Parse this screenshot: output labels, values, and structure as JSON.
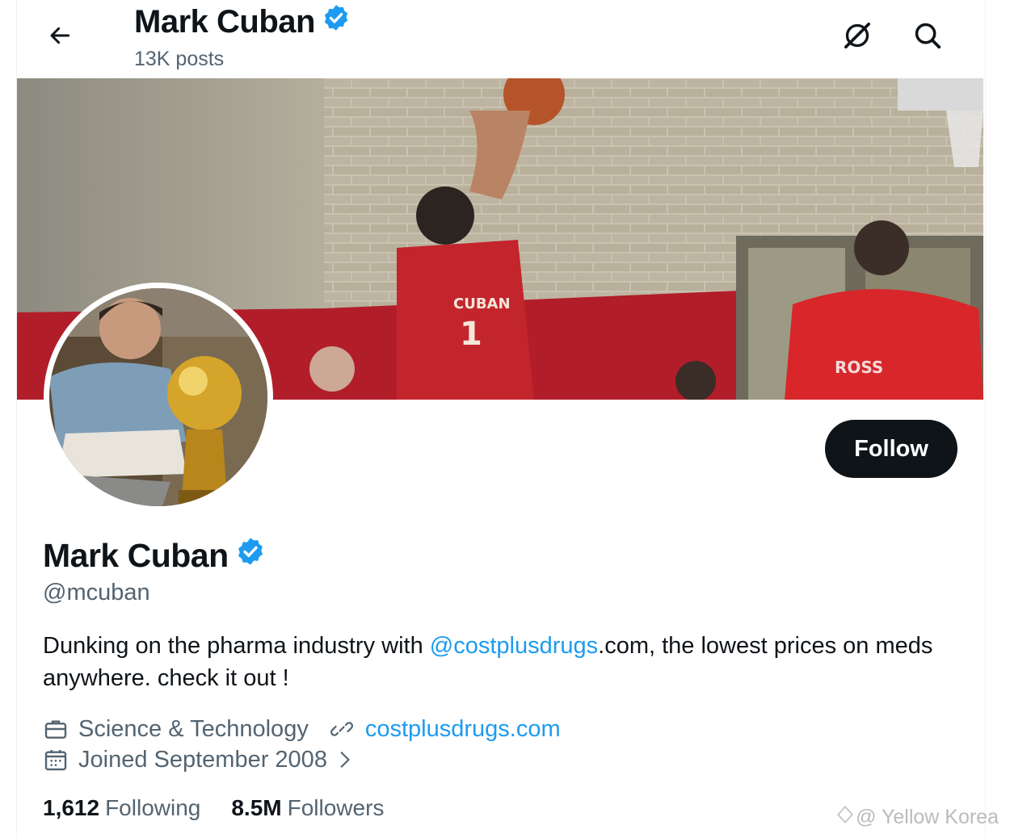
{
  "header": {
    "name": "Mark Cuban",
    "posts": "13K posts"
  },
  "profile": {
    "name": "Mark Cuban",
    "handle": "@mcuban",
    "follow_label": "Follow",
    "bio_prefix": "Dunking on the pharma industry with ",
    "bio_mention": "@costplusdrugs",
    "bio_suffix": ".com, the lowest prices on meds anywhere. check it out !",
    "category": "Science & Technology",
    "website": "costplusdrugs.com",
    "joined": "Joined September 2008",
    "following_count": "1,612",
    "following_label": "Following",
    "followers_count": "8.5M",
    "followers_label": "Followers"
  },
  "banner_jersey_texts": [
    "CUBAN",
    "1",
    "ROSS"
  ],
  "watermark": "@ Yellow Korea",
  "colors": {
    "accent": "#1d9bf0",
    "text": "#0f1419",
    "secondary": "#536471",
    "button": "#0f1419"
  }
}
